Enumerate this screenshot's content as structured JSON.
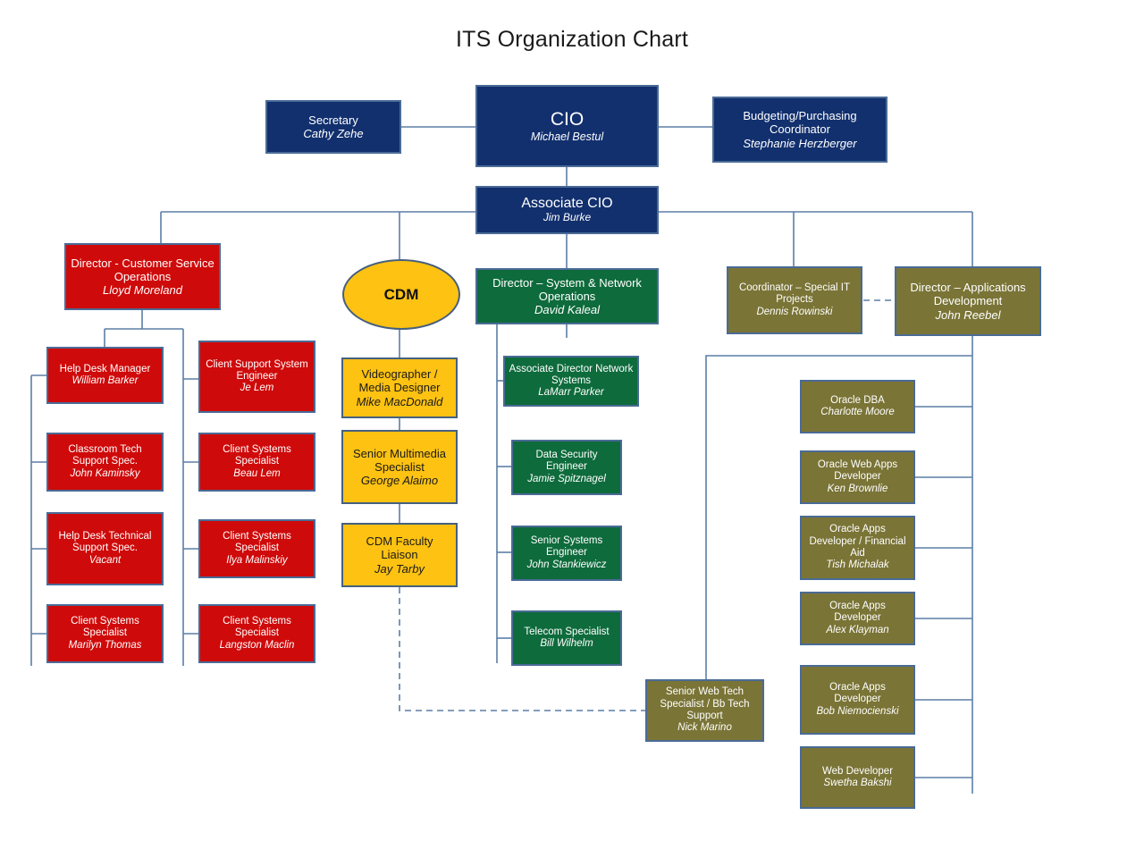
{
  "title": "ITS Organization Chart",
  "palette": {
    "navy": "#12306e",
    "red": "#cf0a0a",
    "green": "#0e6b3c",
    "olive": "#7a7436",
    "gold": "#fdc212",
    "border": "#4a6b96",
    "connector": "#5b7fa6",
    "background": "#ffffff"
  },
  "chart_data": {
    "type": "diagram",
    "subtype": "organization-chart",
    "title": "ITS Organization Chart",
    "nodes": [
      {
        "id": "secretary",
        "role": "Secretary",
        "person": "Cathy Zehe",
        "color": "navy"
      },
      {
        "id": "cio",
        "role": "CIO",
        "person": "Michael Bestul",
        "color": "navy"
      },
      {
        "id": "budgeting",
        "role": "Budgeting/Purchasing Coordinator",
        "person": "Stephanie Herzberger",
        "color": "navy"
      },
      {
        "id": "assoc_cio",
        "role": "Associate CIO",
        "person": "Jim Burke",
        "color": "navy"
      },
      {
        "id": "dir_cso",
        "role": "Director - Customer Service Operations",
        "person": "Lloyd Moreland",
        "color": "red"
      },
      {
        "id": "cdm",
        "role": "CDM",
        "person": "",
        "color": "gold"
      },
      {
        "id": "dir_sysnet",
        "role": "Director – System & Network Operations",
        "person": "David Kaleal",
        "color": "green"
      },
      {
        "id": "coord_special",
        "role": "Coordinator – Special IT Projects",
        "person": "Dennis Rowinski",
        "color": "olive"
      },
      {
        "id": "dir_appdev",
        "role": "Director – Applications Development",
        "person": "John Reebel",
        "color": "olive"
      },
      {
        "id": "helpdesk_mgr",
        "role": "Help Desk Manager",
        "person": "William Barker",
        "color": "red"
      },
      {
        "id": "classroom",
        "role": "Classroom Tech Support Spec.",
        "person": "John Kaminsky",
        "color": "red"
      },
      {
        "id": "hd_tech",
        "role": "Help Desk Technical Support Spec.",
        "person": "Vacant",
        "color": "red"
      },
      {
        "id": "css_marilyn",
        "role": "Client Systems Specialist",
        "person": "Marilyn Thomas",
        "color": "red"
      },
      {
        "id": "cs_sys_eng",
        "role": "Client Support System Engineer",
        "person": "Je Lem",
        "color": "red"
      },
      {
        "id": "css_beau",
        "role": "Client Systems Specialist",
        "person": "Beau Lem",
        "color": "red"
      },
      {
        "id": "css_ilya",
        "role": "Client Systems Specialist",
        "person": "Ilya Malinskiy",
        "color": "red"
      },
      {
        "id": "css_langston",
        "role": "Client Systems Specialist",
        "person": "Langston Maclin",
        "color": "red"
      },
      {
        "id": "videographer",
        "role": "Videographer  / Media Designer",
        "person": "Mike MacDonald",
        "color": "gold"
      },
      {
        "id": "sr_multimedia",
        "role": "Senior Multimedia Specialist",
        "person": "George Alaimo",
        "color": "gold"
      },
      {
        "id": "cdm_faculty",
        "role": "CDM Faculty Liaison",
        "person": "Jay Tarby",
        "color": "gold"
      },
      {
        "id": "assoc_dir_net",
        "role": "Associate Director Network Systems",
        "person": "LaMarr Parker",
        "color": "green"
      },
      {
        "id": "data_sec",
        "role": "Data Security Engineer",
        "person": "Jamie Spitznagel",
        "color": "green"
      },
      {
        "id": "sr_sys_eng",
        "role": "Senior Systems Engineer",
        "person": "John Stankiewicz",
        "color": "green"
      },
      {
        "id": "telecom",
        "role": "Telecom Specialist",
        "person": "Bill Wilhelm",
        "color": "green"
      },
      {
        "id": "sr_web_tech",
        "role": "Senior Web Tech Specialist / Bb Tech Support",
        "person": "Nick Marino",
        "color": "olive"
      },
      {
        "id": "oracle_dba",
        "role": "Oracle DBA",
        "person": "Charlotte Moore",
        "color": "olive"
      },
      {
        "id": "oracle_web",
        "role": "Oracle Web Apps Developer",
        "person": "Ken Brownlie",
        "color": "olive"
      },
      {
        "id": "oracle_fa",
        "role": "Oracle Apps Developer / Financial Aid",
        "person": "Tish Michalak",
        "color": "olive"
      },
      {
        "id": "oracle_alex",
        "role": "Oracle Apps Developer",
        "person": "Alex Klayman",
        "color": "olive"
      },
      {
        "id": "oracle_bob",
        "role": "Oracle Apps Developer",
        "person": "Bob Niemocienski",
        "color": "olive"
      },
      {
        "id": "web_dev",
        "role": "Web Developer",
        "person": "Swetha Bakshi",
        "color": "olive"
      }
    ],
    "edges": [
      {
        "from": "cio",
        "to": "secretary",
        "style": "solid"
      },
      {
        "from": "cio",
        "to": "budgeting",
        "style": "solid"
      },
      {
        "from": "cio",
        "to": "assoc_cio",
        "style": "solid"
      },
      {
        "from": "assoc_cio",
        "to": "dir_cso",
        "style": "solid"
      },
      {
        "from": "assoc_cio",
        "to": "cdm",
        "style": "solid"
      },
      {
        "from": "assoc_cio",
        "to": "dir_sysnet",
        "style": "solid"
      },
      {
        "from": "assoc_cio",
        "to": "coord_special",
        "style": "solid"
      },
      {
        "from": "assoc_cio",
        "to": "dir_appdev",
        "style": "solid"
      },
      {
        "from": "coord_special",
        "to": "dir_appdev",
        "style": "dashed"
      },
      {
        "from": "dir_cso",
        "to": "helpdesk_mgr",
        "style": "solid"
      },
      {
        "from": "dir_cso",
        "to": "classroom",
        "style": "solid"
      },
      {
        "from": "dir_cso",
        "to": "hd_tech",
        "style": "solid"
      },
      {
        "from": "dir_cso",
        "to": "css_marilyn",
        "style": "solid"
      },
      {
        "from": "dir_cso",
        "to": "cs_sys_eng",
        "style": "solid"
      },
      {
        "from": "dir_cso",
        "to": "css_beau",
        "style": "solid"
      },
      {
        "from": "dir_cso",
        "to": "css_ilya",
        "style": "solid"
      },
      {
        "from": "dir_cso",
        "to": "css_langston",
        "style": "solid"
      },
      {
        "from": "cdm",
        "to": "videographer",
        "style": "solid"
      },
      {
        "from": "videographer",
        "to": "sr_multimedia",
        "style": "solid"
      },
      {
        "from": "sr_multimedia",
        "to": "cdm_faculty",
        "style": "solid"
      },
      {
        "from": "cdm_faculty",
        "to": "sr_web_tech",
        "style": "dashed"
      },
      {
        "from": "dir_sysnet",
        "to": "assoc_dir_net",
        "style": "solid"
      },
      {
        "from": "dir_sysnet",
        "to": "data_sec",
        "style": "solid"
      },
      {
        "from": "dir_sysnet",
        "to": "sr_sys_eng",
        "style": "solid"
      },
      {
        "from": "dir_sysnet",
        "to": "telecom",
        "style": "solid"
      },
      {
        "from": "dir_appdev",
        "to": "sr_web_tech",
        "style": "solid"
      },
      {
        "from": "dir_appdev",
        "to": "oracle_dba",
        "style": "solid"
      },
      {
        "from": "dir_appdev",
        "to": "oracle_web",
        "style": "solid"
      },
      {
        "from": "dir_appdev",
        "to": "oracle_fa",
        "style": "solid"
      },
      {
        "from": "dir_appdev",
        "to": "oracle_alex",
        "style": "solid"
      },
      {
        "from": "dir_appdev",
        "to": "oracle_bob",
        "style": "solid"
      },
      {
        "from": "dir_appdev",
        "to": "web_dev",
        "style": "solid"
      }
    ]
  },
  "nodes": {
    "secretary": {
      "role": "Secretary",
      "person": "Cathy Zehe"
    },
    "cio": {
      "role": "CIO",
      "person": "Michael Bestul"
    },
    "budgeting": {
      "role": "Budgeting/Purchasing Coordinator",
      "person": "Stephanie Herzberger"
    },
    "assoc_cio": {
      "role": "Associate CIO",
      "person": "Jim Burke"
    },
    "dir_cso": {
      "role": "Director - Customer Service Operations",
      "person": "Lloyd Moreland"
    },
    "cdm": {
      "role": "CDM"
    },
    "dir_sysnet": {
      "role": "Director – System & Network Operations",
      "person": "David Kaleal"
    },
    "coord_special": {
      "role": "Coordinator – Special IT Projects",
      "person": "Dennis Rowinski"
    },
    "dir_appdev": {
      "role": "Director – Applications Development",
      "person": "John Reebel"
    },
    "helpdesk_mgr": {
      "role": "Help Desk Manager",
      "person": "William Barker"
    },
    "classroom": {
      "role": "Classroom Tech Support Spec.",
      "person": "John Kaminsky"
    },
    "hd_tech": {
      "role": "Help Desk Technical Support Spec.",
      "person": "Vacant"
    },
    "css_marilyn": {
      "role": "Client Systems Specialist",
      "person": "Marilyn Thomas"
    },
    "cs_sys_eng": {
      "role": "Client Support System Engineer",
      "person": "Je Lem"
    },
    "css_beau": {
      "role": "Client Systems Specialist",
      "person": "Beau Lem"
    },
    "css_ilya": {
      "role": "Client Systems Specialist",
      "person": "Ilya Malinskiy"
    },
    "css_langston": {
      "role": "Client Systems Specialist",
      "person": "Langston Maclin"
    },
    "videographer": {
      "role": "Videographer  / Media Designer",
      "person": "Mike MacDonald"
    },
    "sr_multimedia": {
      "role": "Senior Multimedia Specialist",
      "person": "George Alaimo"
    },
    "cdm_faculty": {
      "role": "CDM Faculty Liaison",
      "person": "Jay Tarby"
    },
    "assoc_dir_net": {
      "role": "Associate Director Network Systems",
      "person": "LaMarr Parker"
    },
    "data_sec": {
      "role": "Data Security Engineer",
      "person": "Jamie Spitznagel"
    },
    "sr_sys_eng": {
      "role": "Senior Systems Engineer",
      "person": "John Stankiewicz"
    },
    "telecom": {
      "role": "Telecom Specialist",
      "person": "Bill Wilhelm"
    },
    "sr_web_tech": {
      "role": "Senior Web Tech Specialist / Bb Tech Support",
      "person": "Nick Marino"
    },
    "oracle_dba": {
      "role": "Oracle DBA",
      "person": "Charlotte Moore"
    },
    "oracle_web": {
      "role": "Oracle Web Apps Developer",
      "person": "Ken Brownlie"
    },
    "oracle_fa": {
      "role": "Oracle Apps Developer / Financial Aid",
      "person": "Tish Michalak"
    },
    "oracle_alex": {
      "role": "Oracle Apps Developer",
      "person": "Alex Klayman"
    },
    "oracle_bob": {
      "role": "Oracle Apps Developer",
      "person": "Bob Niemocienski"
    },
    "web_dev": {
      "role": "Web Developer",
      "person": "Swetha Bakshi"
    }
  }
}
